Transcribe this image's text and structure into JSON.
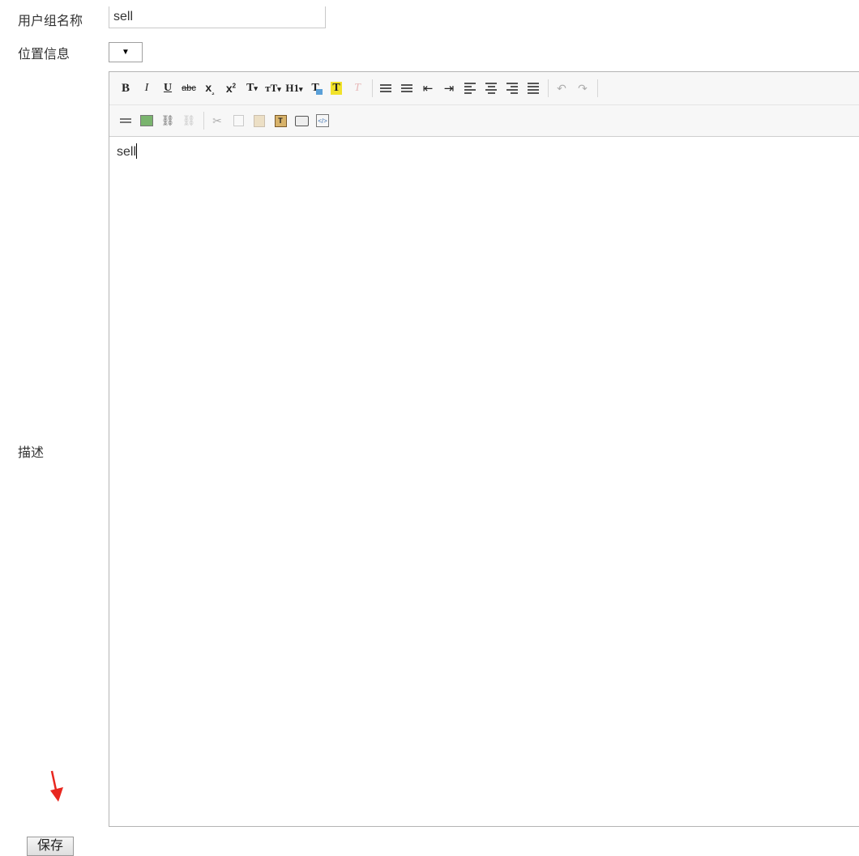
{
  "form": {
    "group_name_label": "用户组名称",
    "group_name_value": "sell",
    "location_label": "位置信息",
    "location_select_glyph": "▼",
    "description_label": "描述",
    "save_label": "保存"
  },
  "editor": {
    "content": "sell",
    "toolbar_row1": [
      {
        "name": "bold-icon",
        "glyph": "B"
      },
      {
        "name": "italic-icon",
        "glyph": "I"
      },
      {
        "name": "underline-icon",
        "glyph": "U"
      },
      {
        "name": "strikethrough-icon",
        "glyph": "abc"
      },
      {
        "name": "subscript-icon",
        "glyph": "x₂"
      },
      {
        "name": "superscript-icon",
        "glyph": "x²"
      },
      {
        "name": "font-family-icon",
        "glyph": "T▾"
      },
      {
        "name": "font-size-icon",
        "glyph": "тT▾"
      },
      {
        "name": "heading-icon",
        "glyph": "H1▾"
      },
      {
        "name": "text-color-icon",
        "glyph": "T"
      },
      {
        "name": "highlight-icon",
        "glyph": "T"
      },
      {
        "name": "remove-format-icon",
        "glyph": "T"
      },
      {
        "name": "bullet-list-icon",
        "glyph": "☰"
      },
      {
        "name": "numbered-list-icon",
        "glyph": "☷"
      },
      {
        "name": "outdent-icon",
        "glyph": "⇤"
      },
      {
        "name": "indent-icon",
        "glyph": "⇥"
      },
      {
        "name": "align-left-icon",
        "glyph": "≡"
      },
      {
        "name": "align-center-icon",
        "glyph": "≡"
      },
      {
        "name": "align-right-icon",
        "glyph": "≡"
      },
      {
        "name": "align-justify-icon",
        "glyph": "≡"
      },
      {
        "name": "undo-icon",
        "glyph": "↶"
      },
      {
        "name": "redo-icon",
        "glyph": "↷"
      }
    ],
    "toolbar_row2": [
      {
        "name": "horizontal-rule-icon",
        "glyph": "═"
      },
      {
        "name": "image-icon",
        "glyph": "▣"
      },
      {
        "name": "link-icon",
        "glyph": "⛓"
      },
      {
        "name": "unlink-icon",
        "glyph": "⛓"
      },
      {
        "name": "cut-icon",
        "glyph": "✂"
      },
      {
        "name": "copy-icon",
        "glyph": "⎘"
      },
      {
        "name": "paste-icon",
        "glyph": "📋"
      },
      {
        "name": "paste-text-icon",
        "glyph": "T"
      },
      {
        "name": "print-icon",
        "glyph": "⎙"
      },
      {
        "name": "source-code-icon",
        "glyph": "</>"
      }
    ]
  },
  "colors": {
    "arrow": "#e8271f",
    "text_color_swatch": "#5aa0d8",
    "highlight_swatch": "#f1e22a"
  }
}
